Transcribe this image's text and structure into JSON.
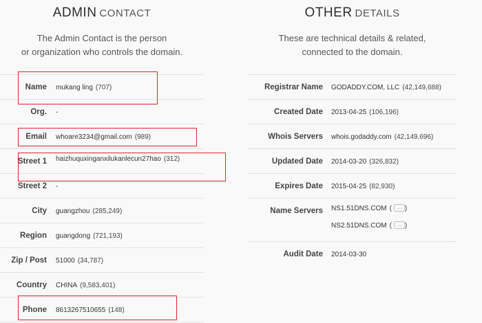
{
  "admin": {
    "heading_strong": "ADMIN",
    "heading_light": "CONTACT",
    "description_line1": "The Admin Contact is the person",
    "description_line2": "or organization who controls the domain.",
    "rows": [
      {
        "label": "Name",
        "value": "mukang ling",
        "count": "(707)"
      },
      {
        "label": "Org.",
        "value": "-",
        "count": ""
      },
      {
        "label": "Email",
        "value": "whoare3234@gmail.com",
        "count": "(989)"
      },
      {
        "label": "Street 1",
        "value": "haizhuquxinganxilukanlecun27hao",
        "count": "(312)"
      },
      {
        "label": "Street 2",
        "value": "-",
        "count": ""
      },
      {
        "label": "City",
        "value": "guangzhou",
        "count": "(285,249)"
      },
      {
        "label": "Region",
        "value": "guangdong",
        "count": "(721,193)"
      },
      {
        "label": "Zip / Post",
        "value": "51000",
        "count": "(34,787)"
      },
      {
        "label": "Country",
        "value": "CHINA",
        "count": "(9,583,401)"
      },
      {
        "label": "Phone",
        "value": "8613267510655",
        "count": "(148)"
      }
    ]
  },
  "other": {
    "heading_strong": "OTHER",
    "heading_light": "DETAILS",
    "description_line1": "These are technical details & related,",
    "description_line2": "connected to the domain.",
    "rows": [
      {
        "label": "Registrar Name",
        "value": "GODADDY.COM, LLC",
        "count": "(42,149,688)"
      },
      {
        "label": "Created Date",
        "value": "2013-04-25",
        "count": "(106,196)"
      },
      {
        "label": "Whois Servers",
        "value": "whois.godaddy.com",
        "count": "(42,149,696)"
      },
      {
        "label": "Updated Date",
        "value": "2014-03-20",
        "count": "(326,832)"
      },
      {
        "label": "Expires Date",
        "value": "2015-04-25",
        "count": "(82,930)"
      }
    ],
    "name_servers": {
      "label": "Name Servers",
      "ns1": "NS1.51DNS.COM",
      "ns2": "NS2.51DNS.COM",
      "paren_open": "(",
      "paren_close": ")",
      "btn_glyph": "..."
    },
    "audit": {
      "label": "Audit Date",
      "value": "2014-03-30"
    }
  },
  "highlight_color": "#e0202a"
}
